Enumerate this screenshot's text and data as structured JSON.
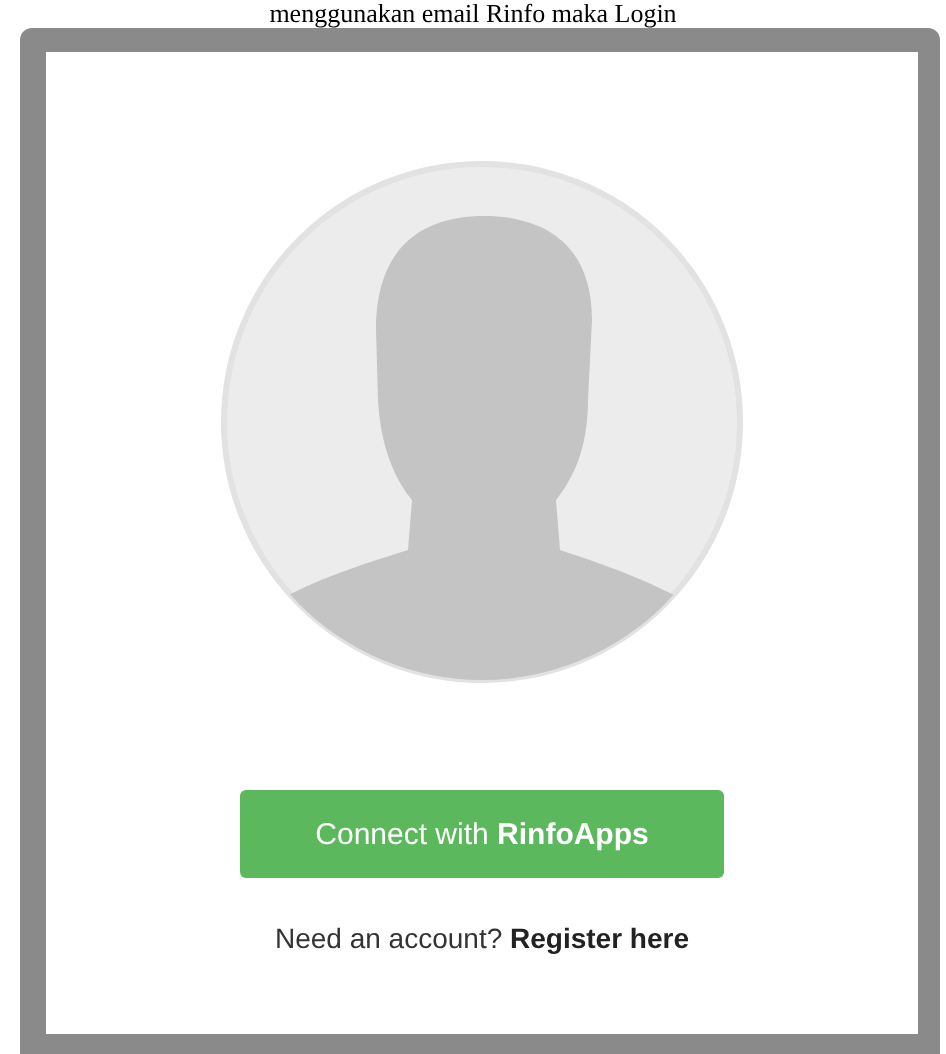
{
  "heading": "menggunakan email Rinfo maka Login",
  "avatar": {
    "kind": "silhouette"
  },
  "connect_button": "Connect with **RinfoApps**",
  "register": {
    "prompt": "Need an account?",
    "link": "Register here"
  }
}
